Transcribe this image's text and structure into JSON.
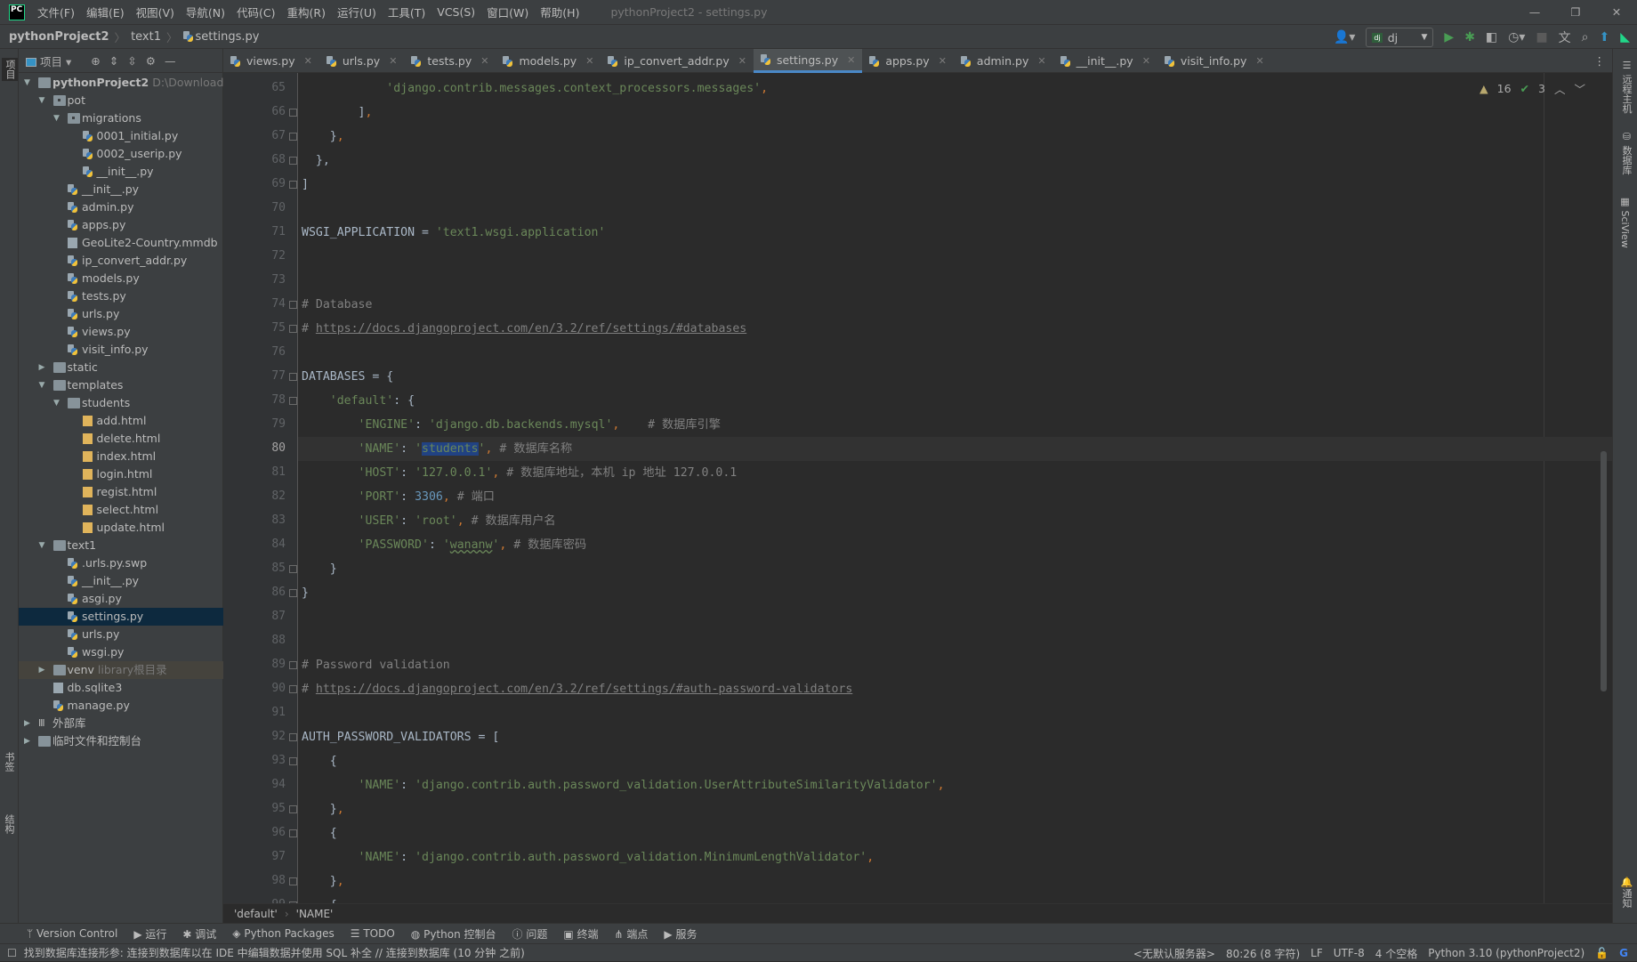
{
  "menubar": {
    "logo": "PC",
    "items": [
      "文件(F)",
      "编辑(E)",
      "视图(V)",
      "导航(N)",
      "代码(C)",
      "重构(R)",
      "运行(U)",
      "工具(T)",
      "VCS(S)",
      "窗口(W)",
      "帮助(H)"
    ],
    "window_title": "pythonProject2 - settings.py"
  },
  "breadcrumb": {
    "project": "pythonProject2",
    "folder": "text1",
    "file": "settings.py"
  },
  "toolbar": {
    "run_config": "dj",
    "run_config_icon": "dj"
  },
  "left_stripe": {
    "project": "项目",
    "bookmarks": "书签",
    "structure": "结构"
  },
  "right_stripe": {
    "remote": "远程主机",
    "database": "数据库",
    "sciview": "SciView",
    "notifications": "通知"
  },
  "project_panel": {
    "title": "项目",
    "tree": [
      {
        "label": "pythonProject2",
        "hint": "D:\\Download\\p",
        "depth": 0,
        "type": "folder",
        "expanded": true,
        "bold": true
      },
      {
        "label": "pot",
        "depth": 1,
        "type": "package",
        "expanded": true
      },
      {
        "label": "migrations",
        "depth": 2,
        "type": "package",
        "expanded": true
      },
      {
        "label": "0001_initial.py",
        "depth": 3,
        "type": "py"
      },
      {
        "label": "0002_userip.py",
        "depth": 3,
        "type": "py"
      },
      {
        "label": "__init__.py",
        "depth": 3,
        "type": "py"
      },
      {
        "label": "__init__.py",
        "depth": 2,
        "type": "py"
      },
      {
        "label": "admin.py",
        "depth": 2,
        "type": "py"
      },
      {
        "label": "apps.py",
        "depth": 2,
        "type": "py"
      },
      {
        "label": "GeoLite2-Country.mmdb",
        "depth": 2,
        "type": "file"
      },
      {
        "label": "ip_convert_addr.py",
        "depth": 2,
        "type": "py"
      },
      {
        "label": "models.py",
        "depth": 2,
        "type": "py"
      },
      {
        "label": "tests.py",
        "depth": 2,
        "type": "py"
      },
      {
        "label": "urls.py",
        "depth": 2,
        "type": "py"
      },
      {
        "label": "views.py",
        "depth": 2,
        "type": "py"
      },
      {
        "label": "visit_info.py",
        "depth": 2,
        "type": "py"
      },
      {
        "label": "static",
        "depth": 1,
        "type": "folder",
        "expanded": false
      },
      {
        "label": "templates",
        "depth": 1,
        "type": "folder",
        "expanded": true
      },
      {
        "label": "students",
        "depth": 2,
        "type": "folder",
        "expanded": true
      },
      {
        "label": "add.html",
        "depth": 3,
        "type": "html"
      },
      {
        "label": "delete.html",
        "depth": 3,
        "type": "html"
      },
      {
        "label": "index.html",
        "depth": 3,
        "type": "html"
      },
      {
        "label": "login.html",
        "depth": 3,
        "type": "html"
      },
      {
        "label": "regist.html",
        "depth": 3,
        "type": "html"
      },
      {
        "label": "select.html",
        "depth": 3,
        "type": "html"
      },
      {
        "label": "update.html",
        "depth": 3,
        "type": "html"
      },
      {
        "label": "text1",
        "depth": 1,
        "type": "folder",
        "expanded": true
      },
      {
        "label": ".urls.py.swp",
        "depth": 2,
        "type": "py"
      },
      {
        "label": "__init__.py",
        "depth": 2,
        "type": "py"
      },
      {
        "label": "asgi.py",
        "depth": 2,
        "type": "py"
      },
      {
        "label": "settings.py",
        "depth": 2,
        "type": "py",
        "selected": true
      },
      {
        "label": "urls.py",
        "depth": 2,
        "type": "py"
      },
      {
        "label": "wsgi.py",
        "depth": 2,
        "type": "py"
      },
      {
        "label": "venv",
        "hint": "library根目录",
        "depth": 1,
        "type": "folder",
        "expanded": false,
        "library": true
      },
      {
        "label": "db.sqlite3",
        "depth": 1,
        "type": "file"
      },
      {
        "label": "manage.py",
        "depth": 1,
        "type": "py"
      },
      {
        "label": "外部库",
        "depth": 0,
        "type": "lib",
        "expanded": false
      },
      {
        "label": "临时文件和控制台",
        "depth": 0,
        "type": "scratch",
        "expanded": false
      }
    ]
  },
  "tabs": [
    {
      "label": "views.py"
    },
    {
      "label": "urls.py"
    },
    {
      "label": "tests.py"
    },
    {
      "label": "models.py"
    },
    {
      "label": "ip_convert_addr.py"
    },
    {
      "label": "settings.py",
      "active": true
    },
    {
      "label": "apps.py"
    },
    {
      "label": "admin.py"
    },
    {
      "label": "__init__.py"
    },
    {
      "label": "visit_info.py"
    }
  ],
  "inspections": {
    "warnings": "16",
    "weak_warnings": "3"
  },
  "editor": {
    "current_line": 80,
    "lines": [
      {
        "n": 65,
        "t": [
          [
            "",
            "            "
          ],
          [
            "str",
            "'django.contrib.messages.context_processors.messages'"
          ],
          [
            "punc",
            ","
          ]
        ]
      },
      {
        "n": 66,
        "fold": true,
        "t": [
          [
            "",
            "        ]"
          ],
          [
            "punc",
            ","
          ]
        ]
      },
      {
        "n": 67,
        "fold": true,
        "t": [
          [
            "",
            "    }"
          ],
          [
            "punc",
            ","
          ]
        ]
      },
      {
        "n": 68,
        "fold": true,
        "t": [
          [
            "",
            "  },"
          ]
        ]
      },
      {
        "n": 69,
        "fold": true,
        "t": [
          [
            "",
            "]"
          ]
        ]
      },
      {
        "n": 70,
        "t": []
      },
      {
        "n": 71,
        "t": [
          [
            "",
            "WSGI_APPLICATION = "
          ],
          [
            "str",
            "'text1.wsgi.application'"
          ]
        ]
      },
      {
        "n": 72,
        "t": []
      },
      {
        "n": 73,
        "t": []
      },
      {
        "n": 74,
        "fold": true,
        "t": [
          [
            "com",
            "# Database"
          ]
        ]
      },
      {
        "n": 75,
        "fold": true,
        "t": [
          [
            "com",
            "# "
          ],
          [
            "url",
            "https://docs.djangoproject.com/en/3.2/ref/settings/#databases"
          ]
        ]
      },
      {
        "n": 76,
        "t": []
      },
      {
        "n": 77,
        "fold": true,
        "t": [
          [
            "",
            "DATABASES = {"
          ]
        ]
      },
      {
        "n": 78,
        "fold": true,
        "t": [
          [
            "",
            "    "
          ],
          [
            "str",
            "'default'"
          ],
          [
            "",
            ": {"
          ]
        ]
      },
      {
        "n": 79,
        "t": [
          [
            "",
            "        "
          ],
          [
            "str",
            "'ENGINE'"
          ],
          [
            "",
            ": "
          ],
          [
            "str",
            "'django.db.backends.mysql'"
          ],
          [
            "punc",
            ","
          ],
          [
            "com",
            "    # 数据库引擎"
          ]
        ]
      },
      {
        "n": 80,
        "t": [
          [
            "",
            "        "
          ],
          [
            "str",
            "'NAME'"
          ],
          [
            "",
            ": "
          ],
          [
            "str",
            "'"
          ],
          [
            "sel",
            "students"
          ],
          [
            "str",
            "'"
          ],
          [
            "punc",
            ","
          ],
          [
            "com",
            " # 数据库名称"
          ]
        ]
      },
      {
        "n": 81,
        "t": [
          [
            "",
            "        "
          ],
          [
            "str",
            "'HOST'"
          ],
          [
            "",
            ": "
          ],
          [
            "str",
            "'127.0.0.1'"
          ],
          [
            "punc",
            ","
          ],
          [
            "com",
            " # 数据库地址，本机 ip 地址 127.0.0.1"
          ]
        ]
      },
      {
        "n": 82,
        "t": [
          [
            "",
            "        "
          ],
          [
            "str",
            "'PORT'"
          ],
          [
            "",
            ": "
          ],
          [
            "num",
            "3306"
          ],
          [
            "punc",
            ","
          ],
          [
            "com",
            " # 端口"
          ]
        ]
      },
      {
        "n": 83,
        "t": [
          [
            "",
            "        "
          ],
          [
            "str",
            "'USER'"
          ],
          [
            "",
            ": "
          ],
          [
            "str",
            "'root'"
          ],
          [
            "punc",
            ","
          ],
          [
            "com",
            " # 数据库用户名"
          ]
        ]
      },
      {
        "n": 84,
        "t": [
          [
            "",
            "        "
          ],
          [
            "str",
            "'PASSWORD'"
          ],
          [
            "",
            ": "
          ],
          [
            "str",
            "'"
          ],
          [
            "wv",
            "wananw"
          ],
          [
            "str",
            "'"
          ],
          [
            "punc",
            ","
          ],
          [
            "com",
            " # 数据库密码"
          ]
        ]
      },
      {
        "n": 85,
        "fold": true,
        "t": [
          [
            "",
            "    }"
          ]
        ]
      },
      {
        "n": 86,
        "fold": true,
        "t": [
          [
            "",
            "}"
          ]
        ]
      },
      {
        "n": 87,
        "t": []
      },
      {
        "n": 88,
        "t": []
      },
      {
        "n": 89,
        "fold": true,
        "t": [
          [
            "com",
            "# Password validation"
          ]
        ]
      },
      {
        "n": 90,
        "fold": true,
        "t": [
          [
            "com",
            "# "
          ],
          [
            "url",
            "https://docs.djangoproject.com/en/3.2/ref/settings/#auth-password-validators"
          ]
        ]
      },
      {
        "n": 91,
        "t": []
      },
      {
        "n": 92,
        "fold": true,
        "t": [
          [
            "",
            "AUTH_PASSWORD_VALIDATORS = ["
          ]
        ]
      },
      {
        "n": 93,
        "fold": true,
        "t": [
          [
            "",
            "    {"
          ]
        ]
      },
      {
        "n": 94,
        "t": [
          [
            "",
            "        "
          ],
          [
            "str",
            "'NAME'"
          ],
          [
            "",
            ": "
          ],
          [
            "str",
            "'django.contrib.auth.password_validation.UserAttributeSimilarityValidator'"
          ],
          [
            "punc",
            ","
          ]
        ]
      },
      {
        "n": 95,
        "fold": true,
        "t": [
          [
            "",
            "    }"
          ],
          [
            "punc",
            ","
          ]
        ]
      },
      {
        "n": 96,
        "fold": true,
        "t": [
          [
            "",
            "    {"
          ]
        ]
      },
      {
        "n": 97,
        "t": [
          [
            "",
            "        "
          ],
          [
            "str",
            "'NAME'"
          ],
          [
            "",
            ": "
          ],
          [
            "str",
            "'django.contrib.auth.password_validation.MinimumLengthValidator'"
          ],
          [
            "punc",
            ","
          ]
        ]
      },
      {
        "n": 98,
        "fold": true,
        "t": [
          [
            "",
            "    }"
          ],
          [
            "punc",
            ","
          ]
        ]
      },
      {
        "n": 99,
        "fold": true,
        "t": [
          [
            "",
            "    {"
          ]
        ]
      }
    ]
  },
  "editor_breadcrumb": [
    "'default'",
    "'NAME'"
  ],
  "tool_windows": [
    "Version Control",
    "运行",
    "调试",
    "Python Packages",
    "TODO",
    "Python 控制台",
    "问题",
    "终端",
    "端点",
    "服务"
  ],
  "status": {
    "message": "找到数据库连接形参: 连接到数据库以在 IDE 中编辑数据并使用 SQL 补全 // 连接到数据库 (10 分钟 之前)",
    "server": "<无默认服务器>",
    "position": "80:26 (8 字符)",
    "line_sep": "LF",
    "encoding": "UTF-8",
    "indent": "4 个空格",
    "interpreter": "Python 3.10 (pythonProject2)"
  },
  "colors": {
    "accent": "#4a88c7",
    "selection": "#214283",
    "string": "#6a8759",
    "comment": "#808080",
    "number": "#6897bb",
    "keyword": "#cc7832"
  }
}
